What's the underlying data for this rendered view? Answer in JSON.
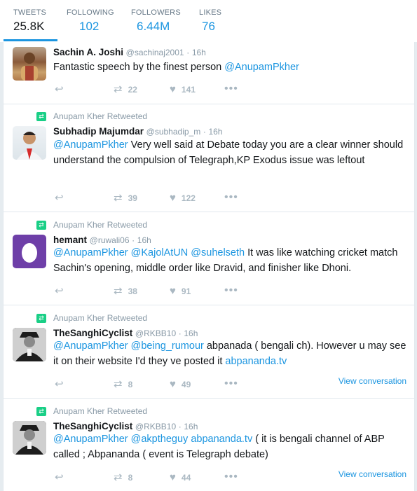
{
  "nav": {
    "stats": [
      {
        "label": "TWEETS",
        "value": "25.8K"
      },
      {
        "label": "FOLLOWING",
        "value": "102"
      },
      {
        "label": "FOLLOWERS",
        "value": "6.44M"
      },
      {
        "label": "LIKES",
        "value": "76"
      }
    ]
  },
  "icons": {
    "reply": "reply-icon",
    "retweet": "retweet-icon",
    "like": "heart-icon",
    "more": "more-icon"
  },
  "colors": {
    "accent": "#1b95e0",
    "retweet_green": "#19cf86"
  },
  "tweets": [
    {
      "retweet_label": "",
      "fullname": "Sachin A. Joshi",
      "handle": "@sachinaj2001",
      "time": "16h",
      "text_before": "Fantastic speech by the finest person  ",
      "mention1": "@AnupamPkher",
      "retweets": "22",
      "likes": "141"
    },
    {
      "retweet_label": "Anupam Kher Retweeted",
      "fullname": "Subhadip Majumdar",
      "handle": "@subhadip_m",
      "time": "16h",
      "mention1": "@AnupamPkher",
      "text_after": " Very well said at Debate today you are a clear winner should understand the compulsion of Telegraph,KP Exodus issue was leftout",
      "retweets": "39",
      "likes": "122"
    },
    {
      "retweet_label": "Anupam Kher Retweeted",
      "fullname": "hemant",
      "handle": "@ruwali06",
      "time": "16h",
      "mention1": "@AnupamPkher",
      "mention2": "@KajolAtUN",
      "mention3": "@suhelseth",
      "text_after": " It was like watching cricket match Sachin's opening, middle order like Dravid, and finisher like Dhoni.",
      "retweets": "38",
      "likes": "91"
    },
    {
      "retweet_label": "Anupam Kher Retweeted",
      "fullname": "TheSanghiCyclist",
      "handle": "@RKBB10",
      "time": "16h",
      "mention1": "@AnupamPkher",
      "mention2": "@being_rumour",
      "text_mid": " abpanada ( bengali ch). However u may see it on their website I'd they ve posted it ",
      "link": "abpananda.tv",
      "retweets": "8",
      "likes": "49",
      "view_conversation": "View conversation"
    },
    {
      "retweet_label": "Anupam Kher Retweeted",
      "fullname": "TheSanghiCyclist",
      "handle": "@RKBB10",
      "time": "16h",
      "mention1": "@AnupamPkher",
      "mention2": "@akptheguy",
      "link": "abpananda.tv",
      "text_after": " ( it is bengali channel of ABP called ; Abpananda ( event is Telegraph debate)",
      "retweets": "8",
      "likes": "44",
      "view_conversation": "View conversation"
    }
  ]
}
